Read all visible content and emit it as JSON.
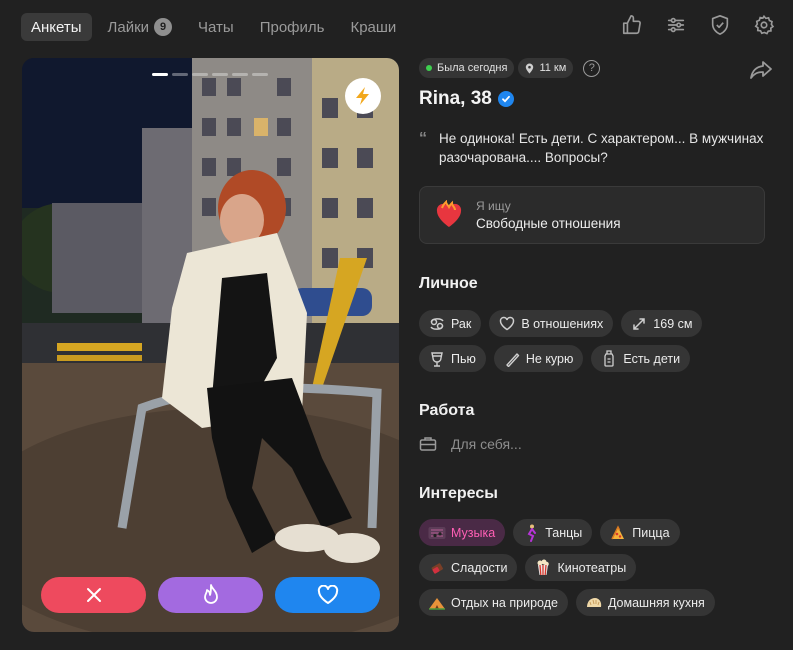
{
  "nav": {
    "tabs": [
      {
        "label": "Анкеты",
        "active": true
      },
      {
        "label": "Лайки",
        "badge": "9"
      },
      {
        "label": "Чаты"
      },
      {
        "label": "Профиль"
      },
      {
        "label": "Краши"
      }
    ],
    "icons": [
      "thumbs-up-icon",
      "filters-icon",
      "shield-check-icon",
      "settings-icon"
    ]
  },
  "photo": {
    "indicators_total": 6,
    "indicators_active": 1,
    "boost_icon": "lightning-icon",
    "actions": [
      "close-icon",
      "flame-icon",
      "heart-icon"
    ],
    "colors": {
      "dislike": "#ee4a5e",
      "superlike": "#a36ae0",
      "like": "#1f86ef"
    }
  },
  "profile": {
    "status": "Была сегодня",
    "distance": "11 км",
    "help": "?",
    "name": "Rina, 38",
    "verified": true,
    "about": "Не одинока! Есть дети. С характером... В мужчинах разочарована.... Вопросы?",
    "seeking": {
      "label": "Я ищу",
      "value": "Свободные отношения",
      "icon": "burning-heart-icon"
    }
  },
  "personal": {
    "title": "Личное",
    "chips": [
      {
        "icon": "cancer-zodiac-icon",
        "label": "Рак"
      },
      {
        "icon": "heart-outline-icon",
        "label": "В отношениях"
      },
      {
        "icon": "height-arrows-icon",
        "label": "169 см"
      },
      {
        "icon": "wine-glass-icon",
        "label": "Пью"
      },
      {
        "icon": "no-smoking-icon",
        "label": "Не курю"
      },
      {
        "icon": "baby-bottle-icon",
        "label": "Есть дети"
      }
    ]
  },
  "work": {
    "title": "Работа",
    "value": "Для себя..."
  },
  "interests": {
    "title": "Интересы",
    "chips": [
      {
        "icon": "music-notes-icon",
        "label": "Музыка"
      },
      {
        "icon": "dancer-icon",
        "label": "Танцы"
      },
      {
        "icon": "pizza-icon",
        "label": "Пицца"
      },
      {
        "icon": "candy-icon",
        "label": "Сладости"
      },
      {
        "icon": "popcorn-icon",
        "label": "Кинотеатры"
      },
      {
        "icon": "camping-icon",
        "label": "Отдых на природе"
      },
      {
        "icon": "dumpling-icon",
        "label": "Домашняя кухня"
      }
    ]
  }
}
